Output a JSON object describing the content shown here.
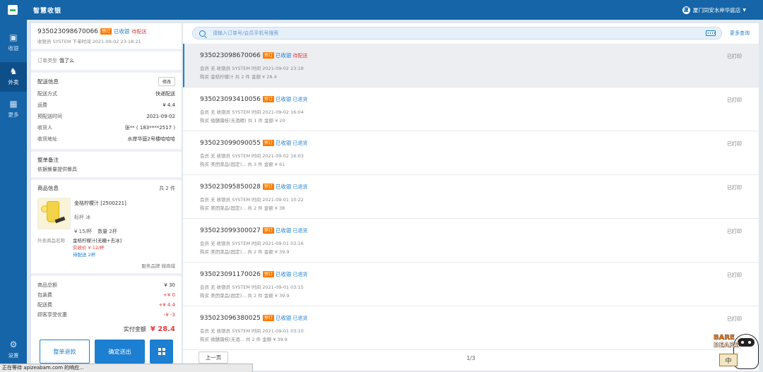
{
  "header": {
    "title": "智慧收银",
    "store_avatar": "厦",
    "store_name": "厦门同安水岸华庭店"
  },
  "sidebar": {
    "items": [
      {
        "label": "收银",
        "icon": "cashier-icon"
      },
      {
        "label": "外卖",
        "icon": "delivery-bike-icon"
      },
      {
        "label": "更多",
        "icon": "grid-icon"
      },
      {
        "label": "设置",
        "icon": "gear-icon"
      }
    ]
  },
  "detail": {
    "order_no": "935023098670066",
    "tag": "预订",
    "status": "已收银",
    "delivery_status": "待配送",
    "cashier_line": "收银员 SYSTEM  下单时间 2021-09-02 23:18:21",
    "order_type_label": "订单类型",
    "order_type_value": "饿了么",
    "delivery": {
      "title": "配送信息",
      "edit_label": "修改",
      "rows": [
        {
          "k": "配送方式",
          "v": "快递配送"
        },
        {
          "k": "运费",
          "v": "¥ 4.4"
        },
        {
          "k": "预配送时间",
          "v": "2021-09-02"
        },
        {
          "k": "收货人",
          "v": "张** ( 183****2517 )"
        },
        {
          "k": "收货地址",
          "v": "水岸华庭2号楼哈哈哈"
        }
      ]
    },
    "remark": {
      "title": "整单备注",
      "text": "依据餐量提供餐具"
    },
    "goods": {
      "title": "商品信息",
      "count": "共 2 件",
      "name": "金桔柠檬汁 [2500221]",
      "spec": "标杯 冰",
      "price_label": "¥ 15/杯",
      "qty_label": "数量 2杯",
      "mapping_label": "外卖商品名称",
      "mapping_value": "金桔柠檬汁[无糖+去冰]",
      "actual_price": "实收价 ¥ 12/杯",
      "pending": "待配送 2杯",
      "brand": "服务品牌 微商城"
    },
    "money": {
      "rows": [
        {
          "k": "商品总额",
          "v": "¥ 30",
          "red": false
        },
        {
          "k": "包装费",
          "v": "+¥ 0",
          "red": true
        },
        {
          "k": "配送费",
          "v": "+¥ 4.4",
          "red": true
        },
        {
          "k": "顾客享受优惠",
          "v": "-¥ -3",
          "red": true
        }
      ],
      "paid_label": "实付金额",
      "paid_value": "¥ 28.4"
    },
    "buttons": {
      "refund": "整单退款",
      "confirm": "确定送出"
    }
  },
  "search": {
    "placeholder": "请输入订单号/会员手机号搜索",
    "more_label": "更多查询"
  },
  "orders": [
    {
      "no": "935023098670066",
      "tag": "预订",
      "status": "已收银",
      "status2": "待配送",
      "status2_color": "#e23b3b",
      "meta": "会员 无   收银员 SYSTEM  时间 2021-09-02 23:18",
      "meta2": "购买 金桔柠檬汁   共 2 件   金额 ¥ 28.4",
      "printed": "已打印"
    },
    {
      "no": "935023093410056",
      "tag": "预订",
      "status": "已收银",
      "status2": "已退货",
      "status2_color": "#1d7fd1",
      "meta": "会员 无   收银员 SYSTEM  时间 2021-09-02 16:04",
      "meta2": "购买 微醺霜枝(无酒精)   共 1 件   金额 ¥ 20",
      "printed": "已打印"
    },
    {
      "no": "935023099090055",
      "tag": "预订",
      "status": "已收银",
      "status2": "已退货",
      "status2_color": "#1d7fd1",
      "meta": "会员 无   收银员 SYSTEM  时间 2021-09-02 16:03",
      "meta2": "购买 美团菜品(固定)...   共 3 件   金额 ¥ 61",
      "printed": "已打印"
    },
    {
      "no": "935023095850028",
      "tag": "预订",
      "status": "已收银",
      "status2": "已退货",
      "status2_color": "#1d7fd1",
      "meta": "会员 无   收银员 SYSTEM  时间 2021-09-01 10:22",
      "meta2": "购买 美团菜品(固定)...   共 2 件   金额 ¥ 38",
      "printed": "已打印"
    },
    {
      "no": "935023099300027",
      "tag": "预订",
      "status": "已收银",
      "status2": "已退货",
      "status2_color": "#1d7fd1",
      "meta": "会员 无   收银员 SYSTEM  时间 2021-09-01 03:16",
      "meta2": "购买 美团菜品(固定)...   共 2 件   金额 ¥ 39.9",
      "printed": "已打印"
    },
    {
      "no": "935023091170026",
      "tag": "预订",
      "status": "已收银",
      "status2": "已退货",
      "status2_color": "#1d7fd1",
      "meta": "会员 无   收银员 SYSTEM  时间 2021-09-01 03:15",
      "meta2": "购买 美团菜品(固定)...   共 2 件   金额 ¥ 39.9",
      "printed": "已打印"
    },
    {
      "no": "935023096380025",
      "tag": "预订",
      "status": "已收银",
      "status2": "已退货",
      "status2_color": "#1d7fd1",
      "meta": "会员 无   收银员 SYSTEM  时间 2021-09-01 03:10",
      "meta2": "购买 微醺霜枝(无酒...   共 2 件   金额 ¥ 39.9",
      "printed": "已打印"
    }
  ],
  "pager": {
    "prev_label": "上一页",
    "page": "1/3"
  },
  "statusbar": {
    "text": "正在等待 apizeabam.com 的响应..."
  },
  "mascot": {
    "word1": "BARE",
    "word2": "BEARS",
    "sign": "中"
  },
  "colors": {
    "brand": "#1565a8",
    "accent": "#1d7fd1",
    "danger": "#e23b3b",
    "tag": "#ff7a00"
  }
}
